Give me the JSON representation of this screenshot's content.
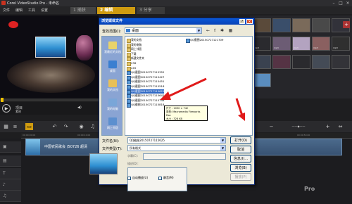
{
  "app": {
    "title": "Corel VideoStudio Pro - 未命名",
    "menu": [
      "文件",
      "编辑",
      "工具",
      "设置"
    ],
    "steps": [
      {
        "num": "1",
        "label": "捕获"
      },
      {
        "num": "2",
        "label": "编辑"
      },
      {
        "num": "3",
        "label": "分享"
      }
    ],
    "player": {
      "project_label": "项目",
      "clip_label": "素材"
    },
    "library": {
      "thumbs": [
        {
          "cap": "",
          "color": "#5a4a3a"
        },
        {
          "cap": "",
          "color": "#3a4e6a"
        },
        {
          "cap": "",
          "color": "#7a6a5a"
        },
        {
          "cap": "",
          "color": "#494949"
        },
        {
          "cap": "",
          "color": "#32323a"
        },
        {
          "cap": "mp3",
          "color": "#2a2a2e"
        },
        {
          "cap": "mp3",
          "color": "#6c5c74"
        },
        {
          "cap": "mp3",
          "color": "#b3a3c0"
        },
        {
          "cap": "mp3",
          "color": "#8a6060"
        },
        {
          "cap": "mp3",
          "color": "#2f2f2f"
        },
        {
          "cap": "",
          "color": "#3a4250"
        },
        {
          "cap": "",
          "color": "#553344"
        },
        {
          "cap": "",
          "color": "#2a2a2e"
        },
        {
          "cap": "",
          "color": "#444b56"
        },
        {
          "cap": "",
          "color": "#333338"
        },
        {
          "cap": "",
          "color": "#5a8dbf"
        }
      ]
    },
    "timeline": {
      "ruler": [
        "00:00:00:00",
        "00:00:10:00",
        "00:00:20:00",
        "00:00:30:00",
        "00:00:40:00",
        "00:00:50:00"
      ],
      "clip_label": "中国农民歌会 (50726 超清",
      "watermark": "Pro"
    }
  },
  "dialog": {
    "title": "浏览媒体文件",
    "help": "?",
    "close": "×",
    "look_in_label": "查找范围(I):",
    "look_in_value": "桌面",
    "places": [
      {
        "label": "我最近的文档",
        "color": "#e9d36a"
      },
      {
        "label": "桌面",
        "color": "#3a7fd1"
      },
      {
        "label": "我的文档",
        "color": "#e8c057"
      },
      {
        "label": "我的电脑",
        "color": "#7aa6d8"
      },
      {
        "label": "网上邻居",
        "color": "#5c8fcf"
      }
    ],
    "files": [
      {
        "name": "我的文档",
        "type": "folder"
      },
      {
        "name": "我的电脑",
        "type": "folder"
      },
      {
        "name": "网上邻居",
        "type": "folder"
      },
      {
        "name": "下载",
        "type": "folder"
      },
      {
        "name": "新建文件夹",
        "type": "folder"
      },
      {
        "name": "236",
        "type": "folder"
      },
      {
        "name": "245",
        "type": "folder"
      },
      {
        "name": "QQ截图20150727115352",
        "type": "img"
      },
      {
        "name": "QQ截图20150727115427",
        "type": "img"
      },
      {
        "name": "QQ截图20150727115451",
        "type": "img"
      },
      {
        "name": "QQ截图20150727115518",
        "type": "img"
      },
      {
        "name": "QQ截图20150727115625",
        "type": "img"
      },
      {
        "name": "QQ截图20150727115642",
        "type": "img"
      },
      {
        "name": "QQ截图20150727115748",
        "type": "img"
      },
      {
        "name": "QQ截图20150727115818",
        "type": "img"
      }
    ],
    "col2_top": {
      "name": "QQ截图20150727121709"
    },
    "selected_index": 11,
    "tooltip": {
      "size_line": "尺寸 : 1090 × 742",
      "type_line": "类型: Macromedia Fireworks Doc",
      "filesize_line": "大小 : 328 KB"
    },
    "filename_label": "文件名(N):",
    "filename_value": "QQ截图20150727115625",
    "filetype_label": "文件类型(T):",
    "filetype_value": "所有格式",
    "open_btn": "打开(O)",
    "cancel_btn": "取消",
    "info_btn": "信息(I)...",
    "browse_btn": "浏览(B)",
    "play_btn": "播放(P)",
    "subtitle_label": "字幕(C):",
    "desc_label": "描述(D):",
    "scene_check_label": "自动播放(U)",
    "mute_check_label": "静音(M)"
  }
}
